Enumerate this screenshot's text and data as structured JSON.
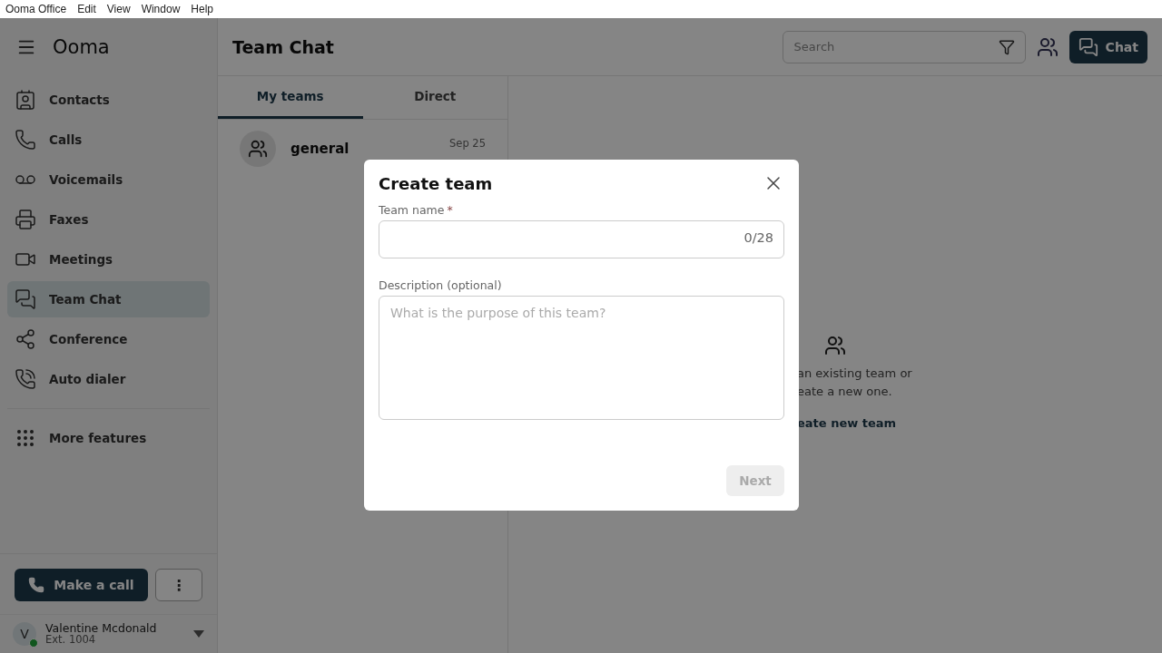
{
  "menu_bar": [
    "Ooma Office",
    "Edit",
    "View",
    "Window",
    "Help"
  ],
  "sidebar": {
    "logo": "Ooma",
    "items": [
      {
        "label": "Contacts",
        "selected": false
      },
      {
        "label": "Calls",
        "selected": false
      },
      {
        "label": "Voicemails",
        "selected": false
      },
      {
        "label": "Faxes",
        "selected": false
      },
      {
        "label": "Meetings",
        "selected": false
      },
      {
        "label": "Team Chat",
        "selected": true
      },
      {
        "label": "Conference",
        "selected": false
      },
      {
        "label": "Auto dialer",
        "selected": false
      }
    ],
    "more": "More features",
    "call_button": "Make a call",
    "more_button": "⋮",
    "user": {
      "initial": "V",
      "name": "Valentine Mcdonald",
      "ext": "Ext. 1004",
      "online": true
    }
  },
  "header": {
    "title": "Team Chat",
    "search": {
      "placeholder": "Search"
    },
    "chat_button": "Chat"
  },
  "tabs": [
    {
      "label": "My teams",
      "selected": true
    },
    {
      "label": "Direct",
      "selected": false
    }
  ],
  "teams": [
    {
      "name": "general",
      "date": "Sep 25"
    }
  ],
  "empty_state": {
    "lines": [
      "an existing team or",
      "eate a new one."
    ],
    "link": "eate new team"
  },
  "dialog": {
    "title": "Create team",
    "name_label": "Team name",
    "required_mark": "*",
    "counter": "0/28",
    "description_label": "Description (optional)",
    "description": {
      "placeholder": "What is the purpose of this team?"
    },
    "next": {
      "label": "Next",
      "disabled": true
    }
  }
}
